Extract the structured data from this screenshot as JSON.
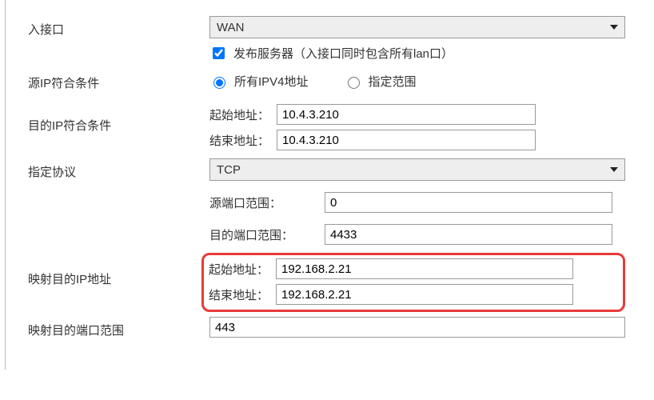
{
  "inInterface": {
    "label": "入接口",
    "value": "WAN",
    "publishLabel": "发布服务器（入接口同时包含所有lan口）",
    "publishChecked": true
  },
  "srcIp": {
    "label": "源IP符合条件",
    "option_all": "所有IPV4地址",
    "option_range": "指定范围",
    "selected": "all"
  },
  "dstIp": {
    "label": "目的IP符合条件",
    "startLabel": "起始地址：",
    "endLabel": "结束地址：",
    "start": "10.4.3.210",
    "end": "10.4.3.210"
  },
  "protocol": {
    "label": "指定协议",
    "value": "TCP",
    "srcPortLabel": "源端口范围：",
    "dstPortLabel": "目的端口范围：",
    "srcPort": "0",
    "dstPort": "4433"
  },
  "mapIp": {
    "label": "映射目的IP地址",
    "startLabel": "起始地址：",
    "endLabel": "结束地址：",
    "start": "192.168.2.21",
    "end": "192.168.2.21"
  },
  "mapPort": {
    "label": "映射目的端口范围",
    "value": "443"
  }
}
